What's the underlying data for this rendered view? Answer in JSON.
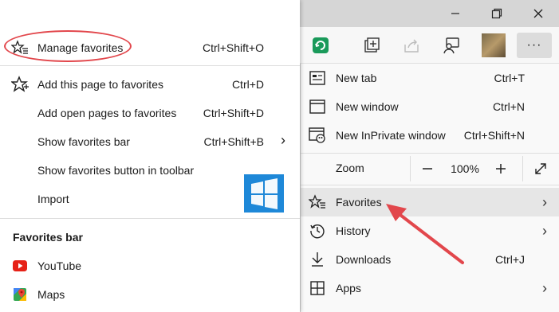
{
  "favorites_menu": {
    "items": [
      {
        "label": "Manage favorites",
        "shortcut": "Ctrl+Shift+O",
        "icon": "star-list-icon"
      },
      {
        "label": "Add this page to favorites",
        "shortcut": "Ctrl+D",
        "icon": "star-outline-icon"
      },
      {
        "label": "Add open pages to favorites",
        "shortcut": "Ctrl+Shift+D",
        "icon": ""
      },
      {
        "label": "Show favorites bar",
        "shortcut": "Ctrl+Shift+B",
        "icon": "",
        "has_submenu": true
      },
      {
        "label": "Show favorites button in toolbar",
        "shortcut": "",
        "icon": ""
      },
      {
        "label": "Import",
        "shortcut": "",
        "icon": ""
      }
    ],
    "favorites_bar_heading": "Favorites bar",
    "bookmarks": [
      {
        "label": "YouTube",
        "icon": "youtube-icon"
      },
      {
        "label": "Maps",
        "icon": "google-maps-icon"
      }
    ]
  },
  "edge_menu": {
    "items": [
      {
        "label": "New tab",
        "shortcut": "Ctrl+T",
        "icon": "new-tab-icon"
      },
      {
        "label": "New window",
        "shortcut": "Ctrl+N",
        "icon": "new-window-icon"
      },
      {
        "label": "New InPrivate window",
        "shortcut": "Ctrl+Shift+N",
        "icon": "inprivate-icon"
      },
      {
        "label": "Favorites",
        "shortcut": "",
        "icon": "star-list-icon",
        "has_submenu": true,
        "highlighted": true
      },
      {
        "label": "History",
        "shortcut": "",
        "icon": "history-icon",
        "has_submenu": true
      },
      {
        "label": "Downloads",
        "shortcut": "Ctrl+J",
        "icon": "download-icon"
      },
      {
        "label": "Apps",
        "shortcut": "",
        "icon": "apps-icon",
        "has_submenu": true
      }
    ],
    "zoom": {
      "label": "Zoom",
      "value": "100%",
      "minus": "—",
      "plus": "+"
    }
  },
  "toolbar": {
    "more_label": "···"
  },
  "colors": {
    "accent_red": "#e2474c",
    "extension_green": "#1a9a5a",
    "windows_blue": "#1e88d8",
    "menu_highlight": "#e6e6e6"
  }
}
